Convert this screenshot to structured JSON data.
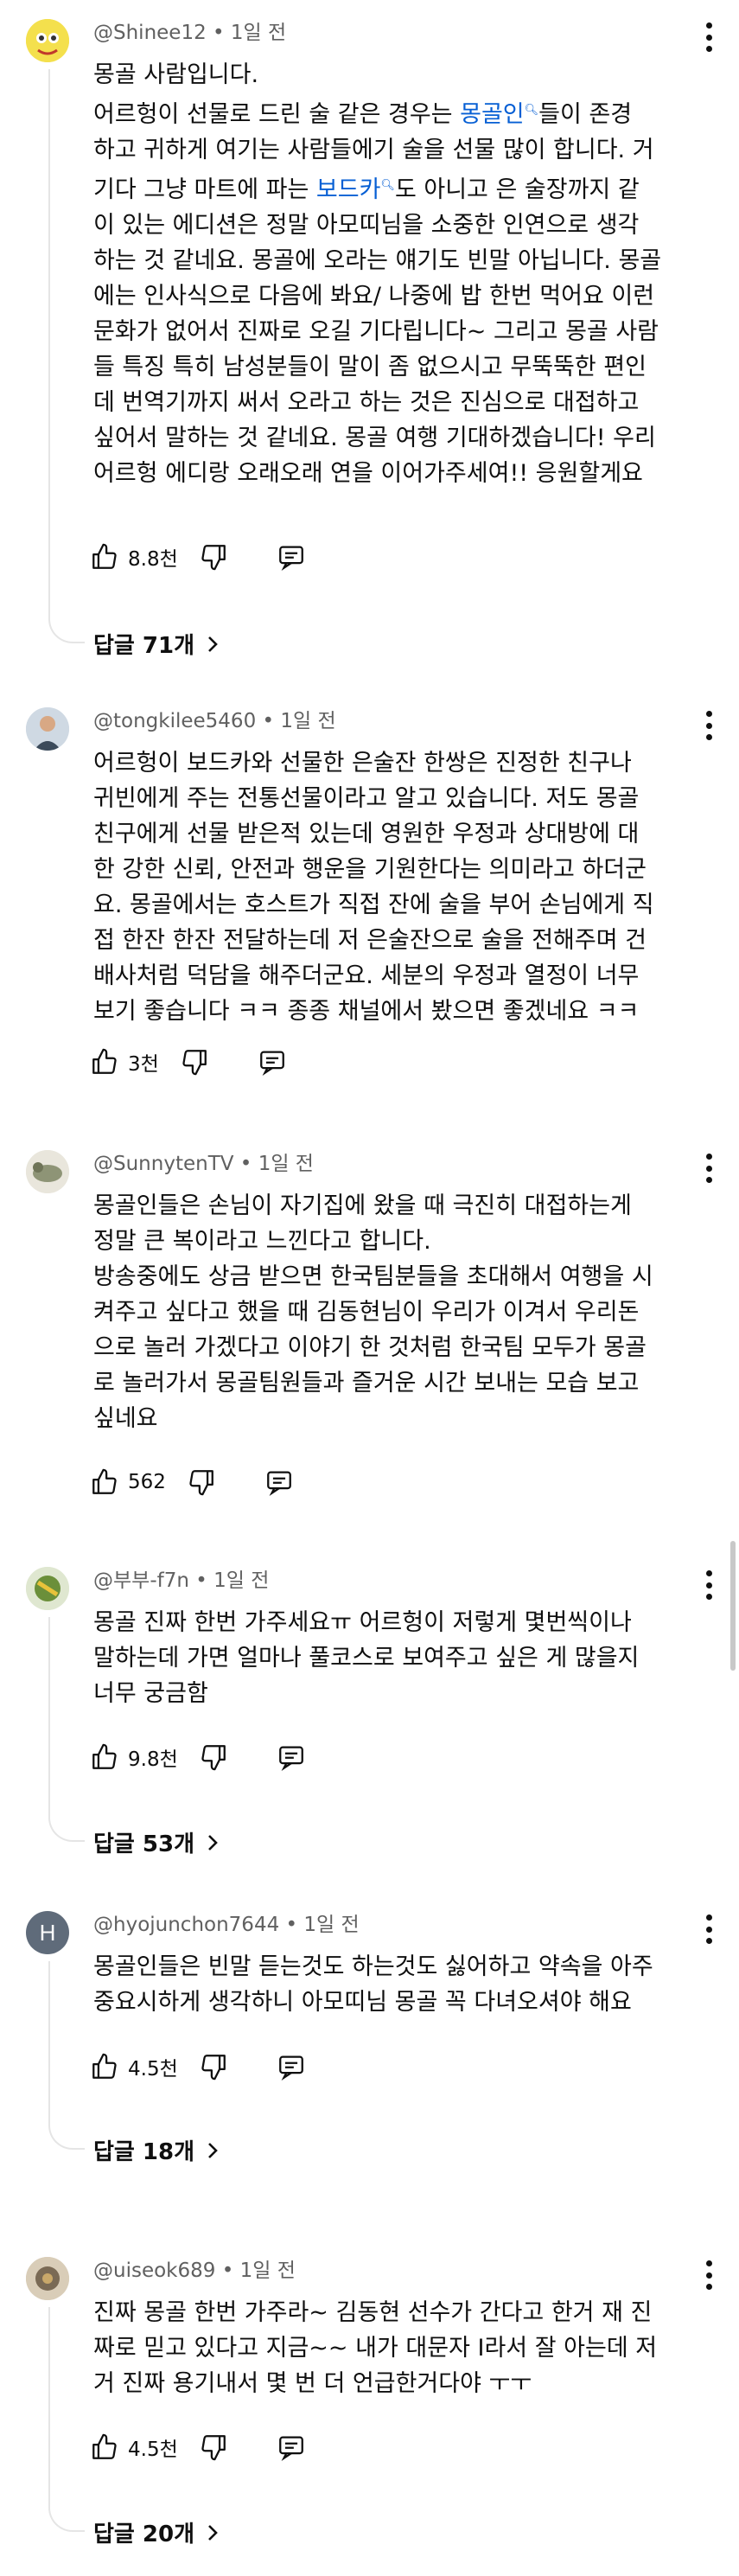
{
  "comments": [
    {
      "author": "@Shinee12",
      "time": "1일 전",
      "avatar_color": "#f4e04d",
      "body": [
        {
          "t": "몽골 사람입니다."
        },
        {
          "t": "어르헝이 선물로 드린 술 같은 경우는 "
        },
        {
          "t": "몽골인",
          "link": true
        },
        {
          "t": "들이 존경"
        },
        {
          "t": "하고 귀하게 여기는 사람들에기 술을 선물 많이 합니다. 거"
        },
        {
          "t": "기다 그냥 마트에 파는 "
        },
        {
          "t": "보드카",
          "link": true
        },
        {
          "t": "도 아니고 은 술장까지 같"
        },
        {
          "t": "이 있는 에디션은 정말 아모띠님을 소중한 인연으로 생각"
        },
        {
          "t": "하는 것 같네요. 몽골에 오라는 얘기도 빈말 아닙니다. 몽골"
        },
        {
          "t": "에는 인사식으로 다음에 봐요/ 나중에 밥 한번 먹어요 이런"
        },
        {
          "t": "문화가 없어서 진짜로 오길 기다립니다~ 그리고 몽골 사람"
        },
        {
          "t": "들 특징 특히 남성분들이 말이 좀 없으시고 무뚝뚝한 편인"
        },
        {
          "t": "데 번역기까지 써서 오라고 하는 것은 진심으로 대접하고"
        },
        {
          "t": "싶어서 말하는 것 같네요. 몽골 여행 기대하겠습니다! 우리"
        },
        {
          "t": "어르헝 에디랑 오래오래 연을 이어가주세여!! 응원할게요"
        }
      ],
      "likes": "8.8천",
      "replies": "답글 71개"
    },
    {
      "author": "@tongkilee5460",
      "time": "1일 전",
      "avatar_color": "#9fb6c8",
      "body": [
        {
          "t": "어르헝이 보드카와 선물한 은술잔 한쌍은 진정한 친구나"
        },
        {
          "t": "귀빈에게 주는 전통선물이라고 알고 있습니다. 저도 몽골"
        },
        {
          "t": "친구에게 선물 받은적 있는데 영원한 우정과 상대방에 대"
        },
        {
          "t": "한 강한 신뢰, 안전과 행운을 기원한다는 의미라고 하더군"
        },
        {
          "t": "요. 몽골에서는 호스트가 직접 잔에 술을 부어 손님에게 직"
        },
        {
          "t": "접 한잔 한잔 전달하는데 저 은술잔으로 술을 전해주며 건"
        },
        {
          "t": "배사처럼 덕담을 해주더군요. 세분의 우정과 열정이 너무"
        },
        {
          "t": "보기 좋습니다 ㅋㅋ 종종 채널에서 봤으면 좋겠네요 ㅋㅋ"
        }
      ],
      "likes": "3천"
    },
    {
      "author": "@SunnytenTV",
      "time": "1일 전",
      "avatar_color": "#8e9476",
      "body": [
        {
          "t": "몽골인들은 손님이 자기집에 왔을 때 극진히 대접하는게"
        },
        {
          "t": "정말 큰 복이라고 느낀다고 합니다."
        },
        {
          "t": "방송중에도 상금 받으면 한국팀분들을 초대해서 여행을 시"
        },
        {
          "t": "켜주고 싶다고 했을 때 김동현님이 우리가 이겨서 우리돈"
        },
        {
          "t": "으로 놀러 가겠다고 이야기 한 것처럼 한국팀 모두가 몽골"
        },
        {
          "t": "로 놀러가서 몽골팀원들과 즐거운 시간 보내는 모습 보고"
        },
        {
          "t": "싶네요"
        }
      ],
      "likes": "562"
    },
    {
      "author": "@부부-f7n",
      "time": "1일 전",
      "avatar_color": "#6b8f3a",
      "body": [
        {
          "t": "몽골 진짜 한번 가주세요ㅠ 어르헝이 저렇게 몇번씩이나"
        },
        {
          "t": "말하는데 가면 얼마나 풀코스로 보여주고 싶은 게 많을지"
        },
        {
          "t": "너무 궁금함"
        }
      ],
      "likes": "9.8천",
      "replies": "답글 53개"
    },
    {
      "author": "@hyojunchon7644",
      "time": "1일 전",
      "avatar_letter": "H",
      "avatar_color": "#5f6b7a",
      "body": [
        {
          "t": "몽골인들은 빈말 듣는것도 하는것도 싫어하고 약속을 아주"
        },
        {
          "t": "중요시하게 생각하니 아모띠님 몽골 꼭 다녀오셔야 해요"
        }
      ],
      "likes": "4.5천",
      "replies": "답글 18개"
    },
    {
      "author": "@uiseok689",
      "time": "1일 전",
      "avatar_color": "#7a6a55",
      "body": [
        {
          "t": "진짜 몽골 한번 가주라~ 김동현 선수가 간다고 한거 재 진"
        },
        {
          "t": "짜로 믿고 있다고 지금~~ 내가 대문자 I라서 잘 아는데 저"
        },
        {
          "t": "거 진짜 용기내서 몇 번 더 언급한거다야 ㅜㅜ"
        }
      ],
      "likes": "4.5천",
      "replies": "답글 20개"
    }
  ],
  "icons": {
    "like": "thumbs-up-icon",
    "dislike": "thumbs-down-icon",
    "reply": "reply-comment-icon",
    "more": "more-vert-icon",
    "chevron": "chevron-right-icon"
  }
}
